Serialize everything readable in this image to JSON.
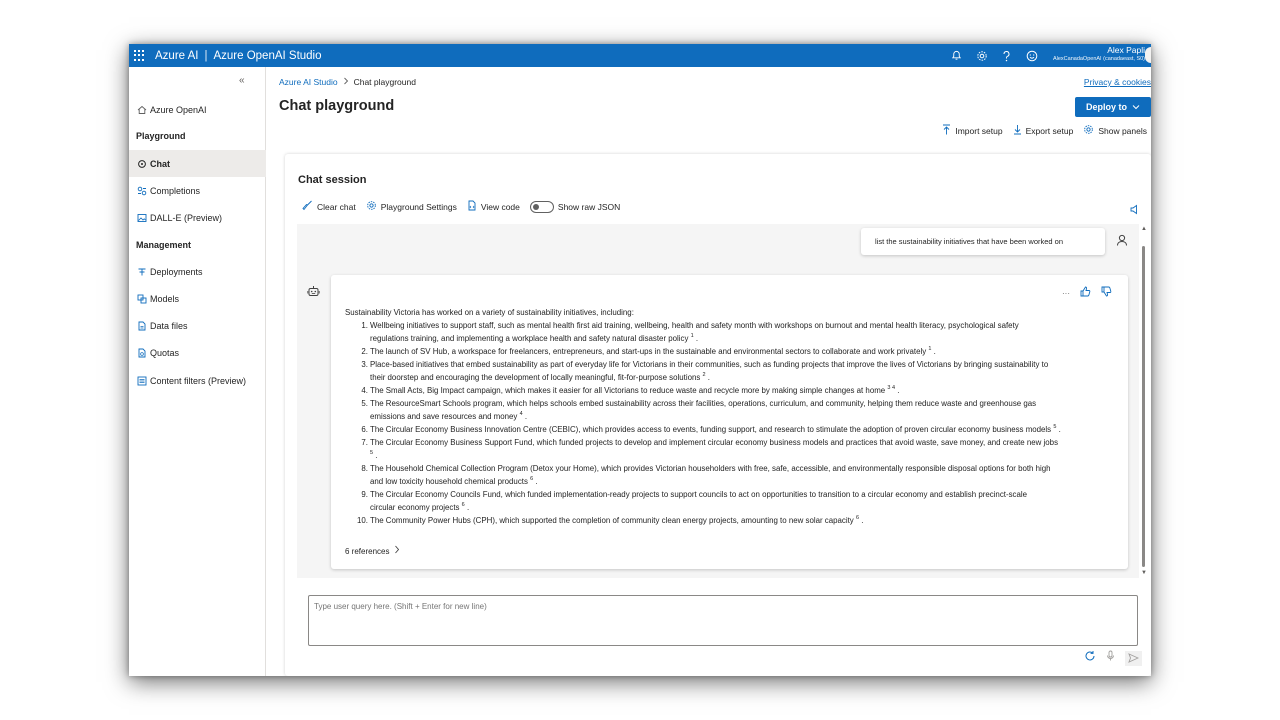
{
  "topbar": {
    "brand": "Azure AI",
    "separator": "|",
    "product": "Azure OpenAI Studio",
    "user_name": "Alex Papli",
    "user_tenant": "AlexCanadaOpenAI (canadaeast, S0)",
    "icons": [
      "bell-icon",
      "gear-icon",
      "help-icon",
      "smiley-icon"
    ]
  },
  "sidebar": {
    "collapse": "«",
    "items": [
      {
        "label": "Azure OpenAI",
        "icon": "home-icon"
      },
      {
        "section": "Playground"
      },
      {
        "label": "Chat",
        "icon": "chat-icon",
        "active": true
      },
      {
        "label": "Completions",
        "icon": "completions-icon"
      },
      {
        "label": "DALL-E (Preview)",
        "icon": "image-icon"
      },
      {
        "section": "Management"
      },
      {
        "label": "Deployments",
        "icon": "deployments-icon"
      },
      {
        "label": "Models",
        "icon": "models-icon"
      },
      {
        "label": "Data files",
        "icon": "file-icon"
      },
      {
        "label": "Quotas",
        "icon": "quota-icon"
      },
      {
        "label": "Content filters (Preview)",
        "icon": "filter-icon"
      }
    ]
  },
  "breadcrumb": {
    "root": "Azure AI Studio",
    "current": "Chat playground"
  },
  "privacy": "Privacy & cookies",
  "page_title": "Chat playground",
  "deploy_label": "Deploy to",
  "actions": {
    "import": "Import setup",
    "export": "Export setup",
    "panels": "Show panels"
  },
  "session": {
    "title": "Chat session",
    "clear": "Clear chat",
    "settings": "Playground Settings",
    "view_code": "View code",
    "raw_json": "Show raw JSON",
    "raw_json_on": false
  },
  "user_message": "list the sustainability initiatives that have been worked on",
  "assistant": {
    "more": "···",
    "intro": "Sustainability Victoria has worked on a variety of sustainability initiatives, including:",
    "items": [
      {
        "n": "1.",
        "lines": [
          "Wellbeing initiatives to support staff, such as mental health first aid training, wellbeing, health and safety month with workshops on burnout and mental health literacy, psychological safety",
          "regulations training, and implementing a workplace health and safety natural disaster policy"
        ],
        "ref": "1",
        "tail": "."
      },
      {
        "n": "2.",
        "lines": [
          "The launch of SV Hub, a workspace for freelancers, entrepreneurs, and start-ups in the sustainable and environmental sectors to collaborate and work privately"
        ],
        "ref": "1",
        "tail": "."
      },
      {
        "n": "3.",
        "lines": [
          "Place-based initiatives that embed sustainability as part of everyday life for Victorians in their communities, such as funding projects that improve the lives of Victorians by bringing sustainability to",
          "their doorstep and encouraging the development of locally meaningful, fit-for-purpose solutions"
        ],
        "ref": "2",
        "tail": "."
      },
      {
        "n": "4.",
        "lines": [
          "The Small Acts, Big Impact campaign, which makes it easier for all Victorians to reduce waste and recycle more by making simple changes at home"
        ],
        "ref": "3 4",
        "tail": "."
      },
      {
        "n": "5.",
        "lines": [
          "The ResourceSmart Schools program, which helps schools embed sustainability across their facilities, operations, curriculum, and community, helping them reduce waste and greenhouse gas",
          "emissions and save resources and money"
        ],
        "ref": "4",
        "tail": "."
      },
      {
        "n": "6.",
        "lines": [
          "The Circular Economy Business Innovation Centre (CEBIC), which provides access to events, funding support, and research to stimulate the adoption of proven circular economy business models"
        ],
        "ref": "5",
        "tail": "."
      },
      {
        "n": "7.",
        "lines": [
          "The Circular Economy Business Support Fund, which funded projects to develop and implement circular economy business models and practices that avoid waste, save money, and create new jobs",
          ""
        ],
        "ref": "5",
        "tail": "."
      },
      {
        "n": "8.",
        "lines": [
          "The Household Chemical Collection Program (Detox your Home), which provides Victorian householders with free, safe, accessible, and environmentally responsible disposal options for both high",
          "and low toxicity household chemical products"
        ],
        "ref": "6",
        "tail": "."
      },
      {
        "n": "9.",
        "lines": [
          "The Circular Economy Councils Fund, which funded implementation-ready projects to support councils to act on opportunities to transition to a circular economy and establish precinct-scale",
          "circular economy projects"
        ],
        "ref": "6",
        "tail": "."
      },
      {
        "n": "10.",
        "lines": [
          "The Community Power Hubs (CPH), which supported the completion of community clean energy projects, amounting to new solar capacity"
        ],
        "ref": "6",
        "tail": "."
      }
    ],
    "references": "6 references",
    "references_chevron": "›"
  },
  "input": {
    "placeholder": "Type user query here. (Shift + Enter for new line)"
  },
  "colors": {
    "accent": "#0f6cbd",
    "active_nav": "#edebe9",
    "chat_bg": "#f5f5f5"
  }
}
